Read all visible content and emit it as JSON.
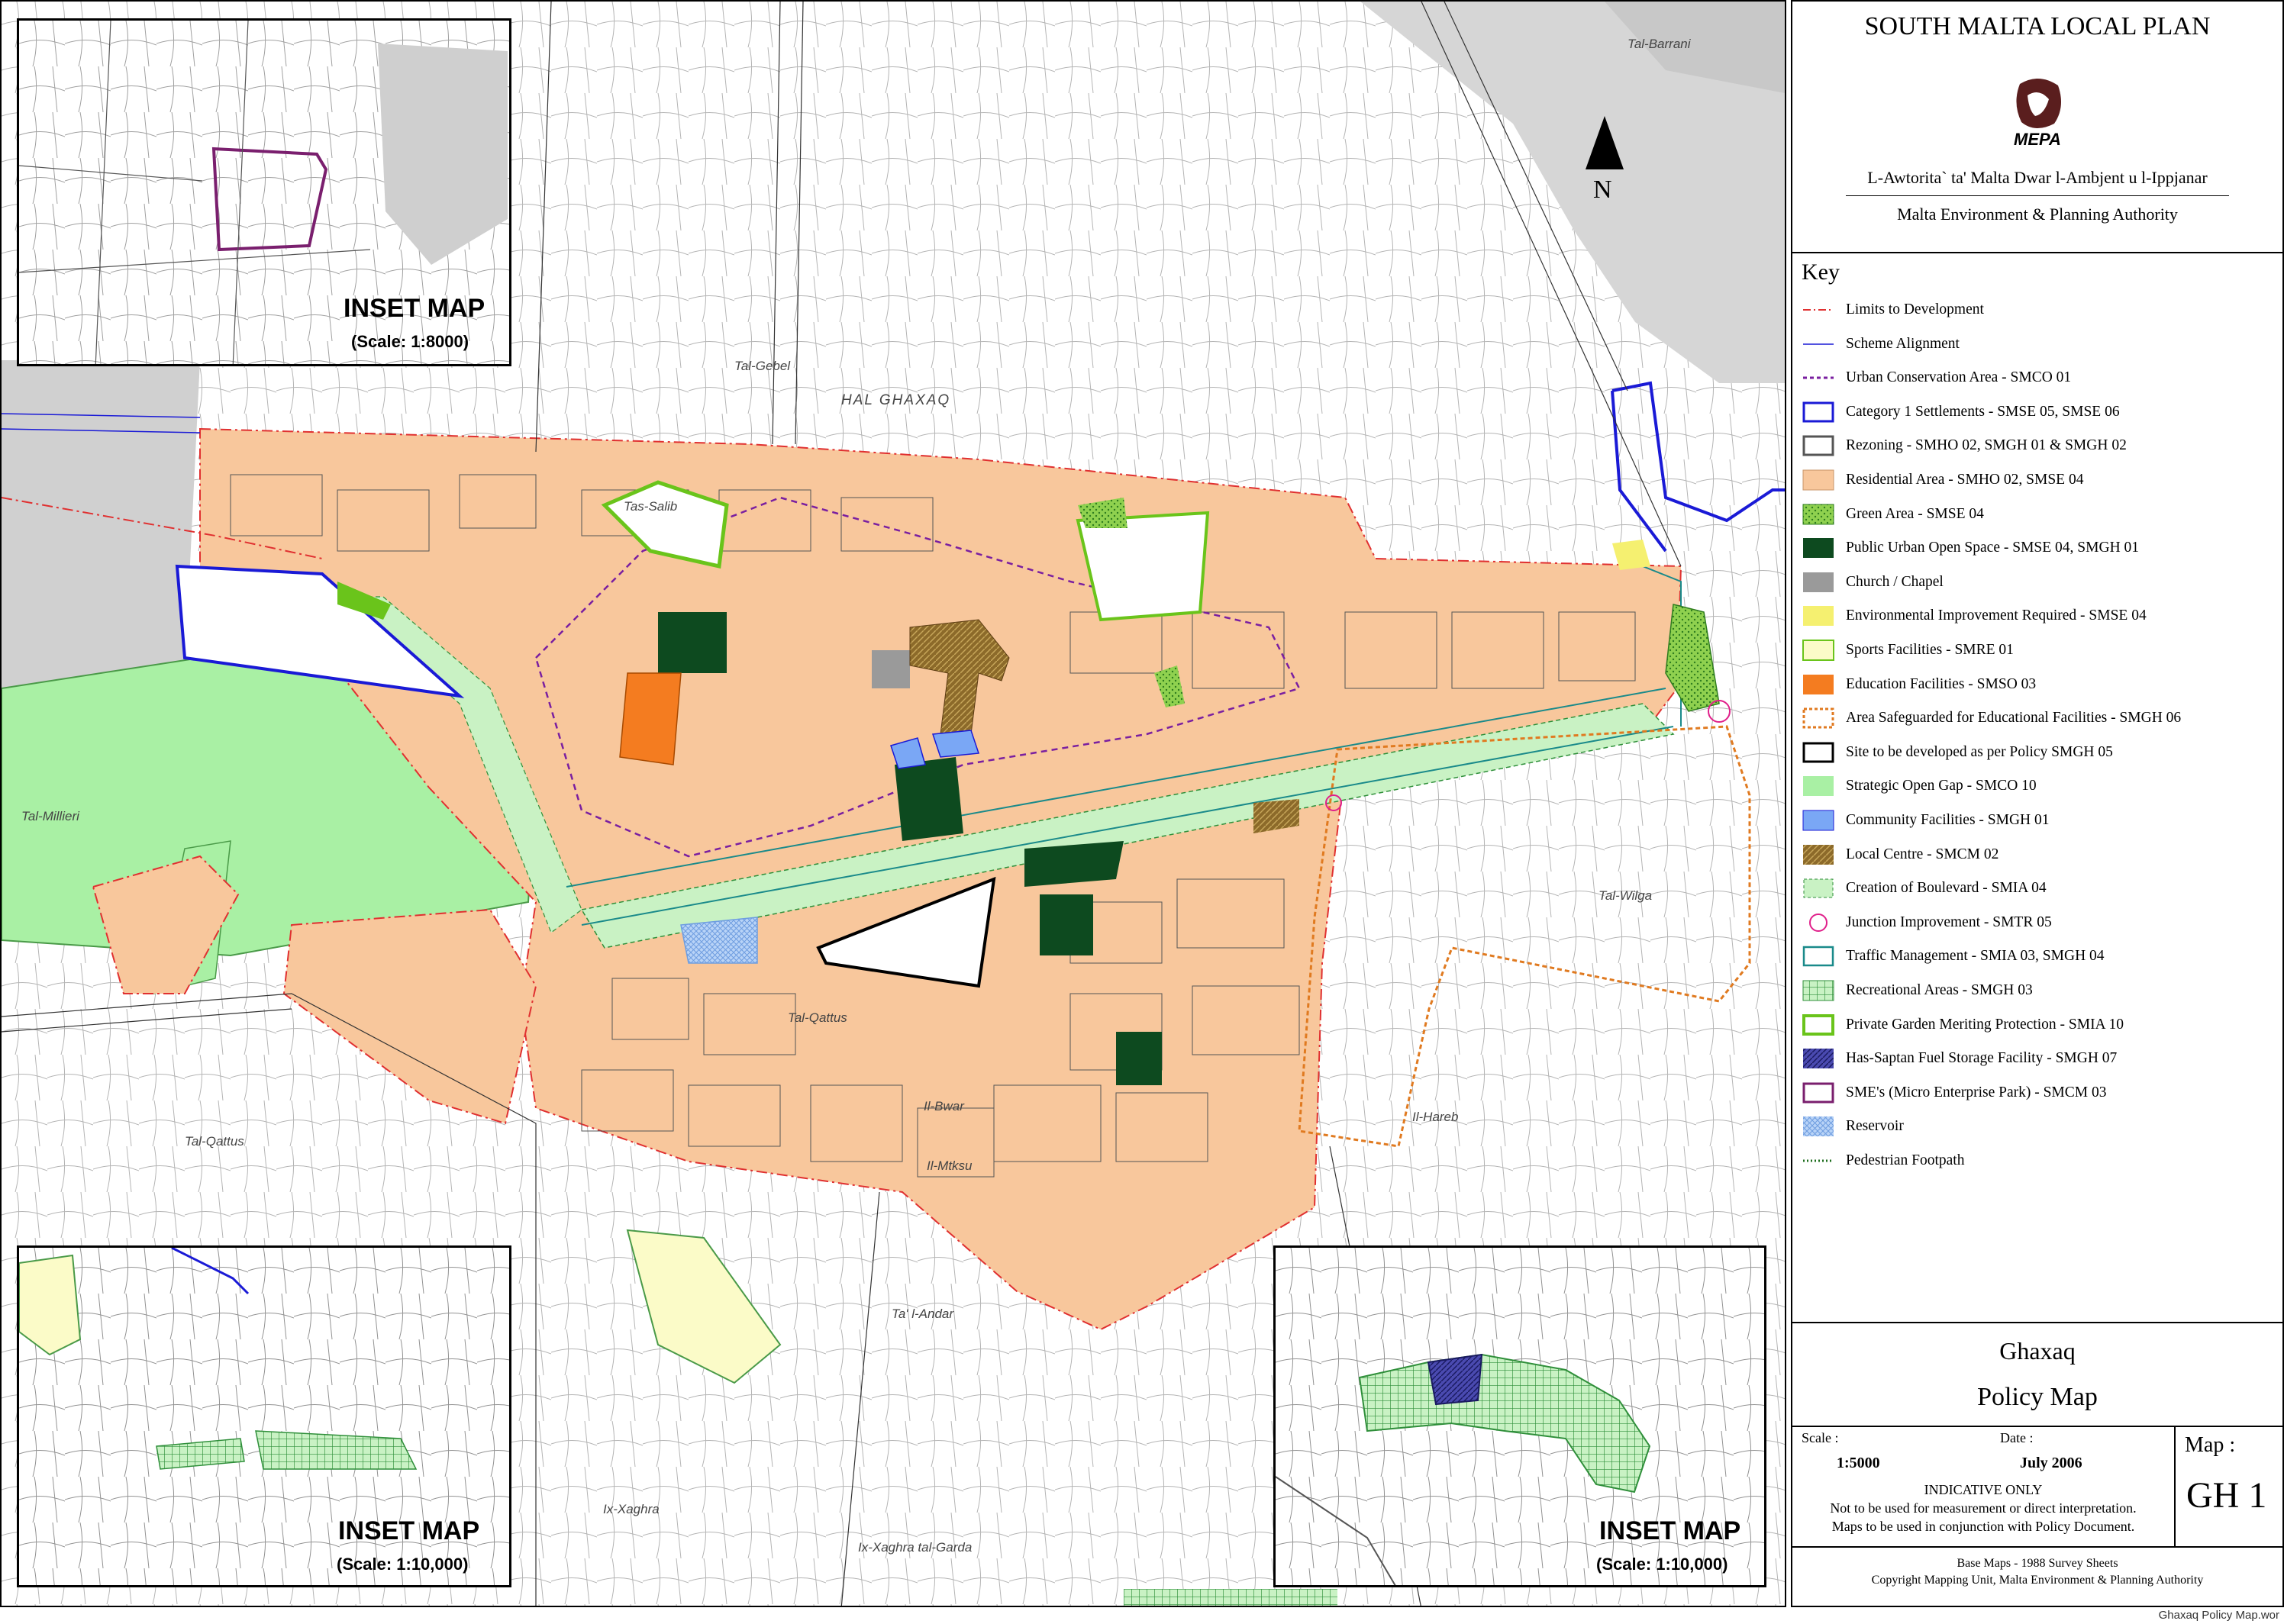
{
  "map": {
    "north_label": "N",
    "places": {
      "tal_gebel": "Tal-Gebel",
      "hal_ghaxaq": "HAL GHAXAQ",
      "tal_barrani": "Tal-Barrani",
      "tas_salib": "Tas-Salib",
      "tal_millieri": "Tal-Millieri",
      "tal_qattus_1": "Tal-Qattus",
      "tal_qattus_2": "Tal-Qattus",
      "il_bwar": "Il-Bwar",
      "il_mtksu": "Il-Mtksu",
      "tal_wilga": "Tal-Wilga",
      "il_hareb": "Il-Hareb",
      "ta_l_andar": "Ta' l-Andar",
      "ix_xaghra": "Ix-Xaghra",
      "ix_xaghra_garda": "Ix-Xaghra tal-Garda"
    },
    "insets": [
      {
        "title": "INSET MAP",
        "scale": "(Scale: 1:8000)"
      },
      {
        "title": "INSET MAP",
        "scale": "(Scale: 1:10,000)"
      },
      {
        "title": "INSET MAP",
        "scale": "(Scale: 1:10,000)"
      }
    ],
    "colors": {
      "residential": "#f8c79c",
      "strategic_gap": "#a9f0a4",
      "public_open_space": "#0d4a1f",
      "education": "#f47c20",
      "community": "#7aa7f5",
      "local_centre": "#8c6a2a",
      "sports": "#fbfbc8",
      "boulevard": "#c9f2c4",
      "settlement_blue": "#1a1ad6",
      "limit_red": "#e03030",
      "safeguard_orange": "#e07a20",
      "church": "#9a9a9a",
      "env_yellow": "#f5f070"
    }
  },
  "panel": {
    "title": "SOUTH MALTA LOCAL PLAN",
    "logo_text": "MEPA",
    "authority_mt": "L-Awtorita` ta' Malta Dwar l-Ambjent u l-Ippjanar",
    "authority_en": "Malta Environment & Planning Authority",
    "key_heading": "Key",
    "key": [
      {
        "label": "Limits to Development",
        "icon": "dash-dot-red-line"
      },
      {
        "label": "Scheme Alignment",
        "icon": "thin-blue-line"
      },
      {
        "label": "Urban Conservation Area - SMCO 01",
        "icon": "purple-dashed-line"
      },
      {
        "label": "Category 1 Settlements - SMSE 05, SMSE 06",
        "icon": "blue-outline-box"
      },
      {
        "label": "Rezoning - SMHO 02, SMGH 01 & SMGH 02",
        "icon": "grey-outline-box"
      },
      {
        "label": "Residential Area - SMHO 02, SMSE 04",
        "icon": "peach-fill"
      },
      {
        "label": "Green Area - SMSE 04",
        "icon": "green-dotted-fill"
      },
      {
        "label": "Public Urban Open Space - SMSE 04, SMGH 01",
        "icon": "dark-green-fill"
      },
      {
        "label": "Church / Chapel",
        "icon": "grey-fill"
      },
      {
        "label": "Environmental Improvement Required - SMSE 04",
        "icon": "yellow-fill"
      },
      {
        "label": "Sports Facilities - SMRE 01",
        "icon": "pale-yellow-green-fill"
      },
      {
        "label": "Education Facilities - SMSO 03",
        "icon": "orange-fill"
      },
      {
        "label": "Area Safeguarded for Educational Facilities - SMGH 06",
        "icon": "orange-dashed-box"
      },
      {
        "label": "Site to be developed as per Policy SMGH 05",
        "icon": "black-outline-box"
      },
      {
        "label": "Strategic Open Gap - SMCO 10",
        "icon": "light-green-fill"
      },
      {
        "label": "Community Facilities - SMGH 01",
        "icon": "blue-fill"
      },
      {
        "label": "Local Centre - SMCM 02",
        "icon": "brown-hatch-fill"
      },
      {
        "label": "Creation of Boulevard - SMIA 04",
        "icon": "pale-green-dashed-fill"
      },
      {
        "label": "Junction Improvement - SMTR 05",
        "icon": "magenta-circle"
      },
      {
        "label": "Traffic Management - SMIA 03, SMGH 04",
        "icon": "teal-outline-box"
      },
      {
        "label": "Recreational Areas - SMGH 03",
        "icon": "green-grid-fill"
      },
      {
        "label": "Private Garden Meriting Protection - SMIA 10",
        "icon": "lime-outline-box"
      },
      {
        "label": "Has-Saptan Fuel Storage Facility - SMGH 07",
        "icon": "navy-hatch-fill"
      },
      {
        "label": "SME's (Micro Enterprise Park) - SMCM 03",
        "icon": "purple-outline-box"
      },
      {
        "label": "Reservoir",
        "icon": "light-blue-hatch-fill"
      },
      {
        "label": "Pedestrian Footpath",
        "icon": "green-dotted-line"
      }
    ],
    "locality": "Ghaxaq",
    "map_title": "Policy Map",
    "scale_label": "Scale :",
    "scale_value": "1:5000",
    "date_label": "Date :",
    "date_value": "July 2006",
    "map_label": "Map :",
    "map_number": "GH 1",
    "indicative": "INDICATIVE ONLY",
    "note1": "Not to be used for measurement or direct interpretation.",
    "note2": "Maps to be used in conjunction with Policy Document.",
    "base1": "Base Maps - 1988 Survey Sheets",
    "base2": "Copyright Mapping Unit, Malta Environment & Planning Authority"
  },
  "footer_filename": "Ghaxaq Policy Map.wor"
}
